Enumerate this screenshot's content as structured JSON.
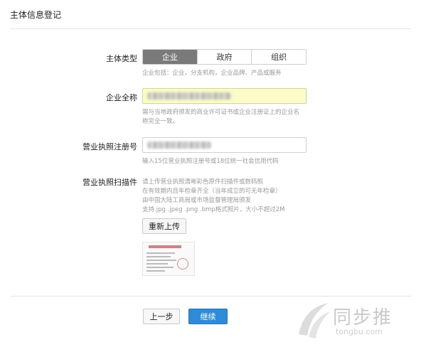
{
  "header": {
    "title": "主体信息登记"
  },
  "subject_type": {
    "label": "主体类型",
    "options": [
      "企业",
      "政府",
      "组织"
    ],
    "selected": "企业",
    "hint": "企业包括：企业，分支机构，企业品牌、产品或服务"
  },
  "company_name": {
    "label": "企业全称",
    "value": "",
    "hint_line1": "需与当地政府颁发的商业许可证书或企业注册证上的企业名",
    "hint_line2": "称完全一致。"
  },
  "license_number": {
    "label": "营业执照注册号",
    "value": "",
    "hint": "输入15位营业执照注册号或18位统一社会信用代码"
  },
  "license_scan": {
    "label": "营业执照扫描件",
    "hint_line1": "请上传营业执照清晰彩色原件扫描件或数码照",
    "hint_line2": "在有效期内且年检章齐全（当年成立的可无年检章）",
    "hint_line3": "由中国大陆工商局或市场监督管理局颁发",
    "hint_line4": "支持.jpg .jpeg .png .bmp格式照片，大小不超过2M",
    "reupload_label": "重新上传"
  },
  "footer": {
    "prev_label": "上一步",
    "next_label": "继续"
  },
  "watermark": {
    "brand": "同步推",
    "url": "tongbu.com"
  },
  "colors": {
    "primary": "#2d8bd8",
    "segment_active": "#7a7a7a",
    "highlight_input": "#fbfcc8"
  }
}
